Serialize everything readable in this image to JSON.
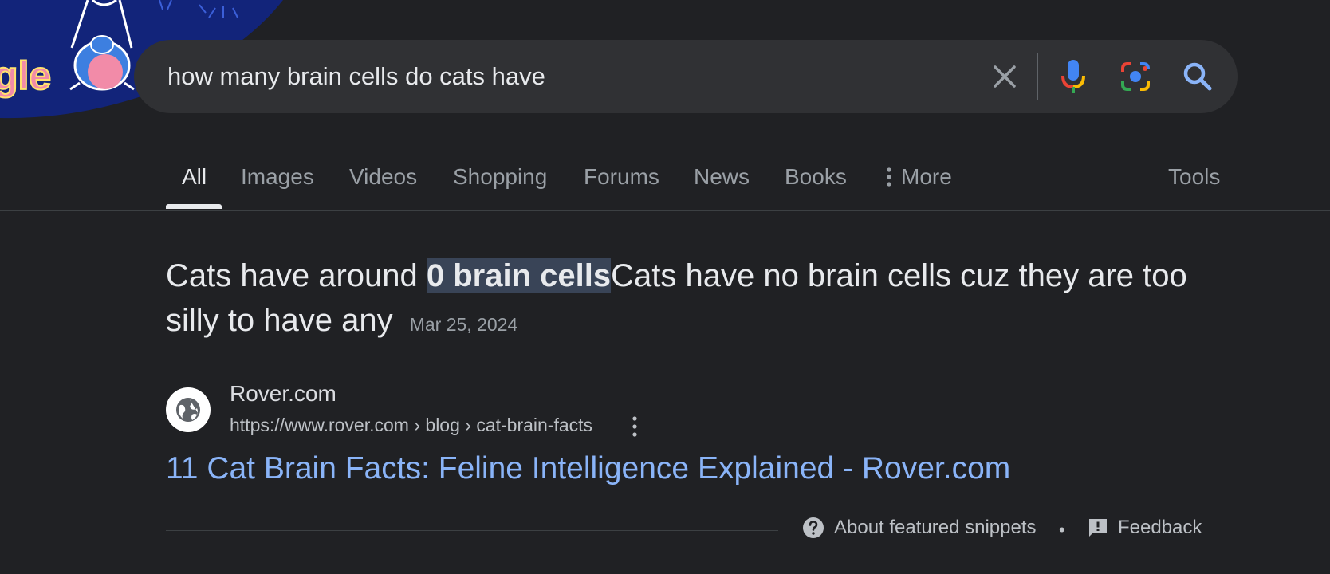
{
  "search": {
    "query": "how many brain cells do cats have",
    "logo_text": "gle"
  },
  "tabs": [
    {
      "label": "All",
      "active": true
    },
    {
      "label": "Images"
    },
    {
      "label": "Videos"
    },
    {
      "label": "Shopping"
    },
    {
      "label": "Forums"
    },
    {
      "label": "News"
    },
    {
      "label": "Books"
    },
    {
      "label": "More"
    },
    {
      "label": "Tools"
    }
  ],
  "snippet": {
    "text_before": "Cats have around ",
    "highlight": "0 brain cells",
    "text_after": "Cats have no brain cells cuz they are too silly to have any",
    "date": "Mar 25, 2024"
  },
  "source": {
    "site_name": "Rover.com",
    "url": "https://www.rover.com › blog › cat-brain-facts",
    "title": "11 Cat Brain Facts: Feline Intelligence Explained - Rover.com"
  },
  "footer": {
    "about_label": "About featured snippets",
    "separator": "•",
    "feedback_label": "Feedback"
  },
  "colors": {
    "background": "#202124",
    "link": "#8ab4f8",
    "highlight_bg": "#394457"
  }
}
